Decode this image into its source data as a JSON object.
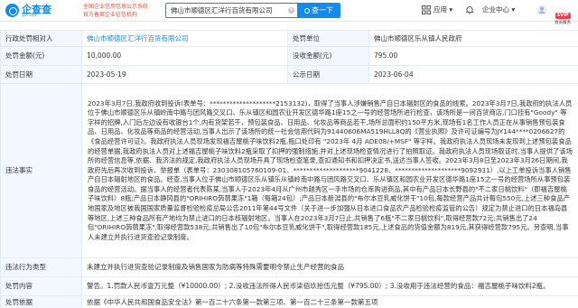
{
  "header": {
    "logo_text": "企查查",
    "logo_sub": "Qcc.com",
    "slogan_line1": "全国企业信用信息公示系统",
    "slogan_line2": "官方备案企业征信机构",
    "search_value": "佛山市顺德区汇洋行百货有限公司",
    "search_button": "查一下",
    "nav_app": "应用",
    "nav_enterprise": "企业中心",
    "svip_badge": "SVIP",
    "svip_label": "会员服务",
    "colors": {
      "brand": "#128bed",
      "slogan": "#e84e3c",
      "label_bg": "#f2f8fe"
    }
  },
  "record": {
    "labels": {
      "party": "行政处罚相对人",
      "authority": "处罚单位",
      "amount": "处罚金额(元)",
      "confiscation": "没收金额(元)",
      "decision_date": "处罚日期",
      "publish_date": "公示日期",
      "facts": "违法事实",
      "violation": "违法行为类型",
      "content": "处罚内容",
      "basis": "处罚依据"
    },
    "party": "佛山市顺德区汇洋行百货有限公司",
    "authority": "佛山市顺德区乐从镇人民政府",
    "amount": "10,000.00",
    "confiscation": "795.00",
    "decision_date": "2023-05-19",
    "publish_date": "2023-06-04",
    "facts": "2023年3月7日,我政府收到投诉(表单号：********************2153132)，取得了当事人涉嫌销售产自日本辐射区的食品的线索。2023年3月7日,我政府的执法人员位于佛山市顺德区乐从镇岭南中路与团风路交叉口、乐从镇区和园农业开发区德华路1座15之一号的经营场所进行检查，该场所是一间百货商店,门口挂有\"Goody\" 等字样的招牌,入门后左边设有收银台1个,内有货架若干，预包装食品、日用品、化妆品等商品若干,场所总面积约150平方米,现场有1名工作人员正在从事销售预包装食品、日用品、化妆品等商品的经营活动,当事人出示了该场所的统一社会信用代码为91440606MA519HLL8Q的《营业执照》及许可证编号为JY144****0206627的《食品经营许可证》。我政府执法人员现场发现福吉屋桃子味饮料2瓶,瓶口处印有 \"2023年 4月 ADE08/+MSF\" 等字样。我政府执法人员现场未发现到上述预包装食品的经营单据,我政府执法人员对上述福吉屋桃子味饮料2瓶采取了扣押的强制措施,并对上述现场检查情况进行了拍照取证。我政府执法人员现场取证时,当事人提供了该场所的经营信息等,依据、我济法的规定,我政府执法人员现场开具了现场检查笔录,查扣通知书和扣押决定书,送达当事人签收。2023年3月8日至2023年3月26日期间,我政府先后再次收到投诉、举报单（表单号：230308105760109-01、********************9041228、********************9092931）,以上工单投诉当事人销售产自日本辐射地区的食品。经查,当事人位于佛山市顺德区乐从镇乐从镇岭南中路与团风路交叉口、乐从镇区和园农业开发区德华路1座15之一号的经营场所从事预包装食品的经营活动。据当事人的经营者代表陈某,当事人于2023年4月从广州市越秀区一手市场的仓库购进商品,其中有产品日本长野县的\"不二家日桃饮料\"（即福吉屋桃子味饮料）8瓶;产品日本静冈县的\"ORIHIRO蒟蒻果冻\"1箱（每箱24包）;产品日本新潟县的\"布尔本豆乳威化饼干\"10包,每款经营产品共计每包550元,上述三种食品产地国家及地区被我国国家质量监督检验检疫总局公告2011年第44号文件（关于进一步加强从日本进口食品农产品检验检疫监管的公告）规定为禁止进口的日本福岛县等地区,上述三种食品所有产地均为禁止进口的日本核辐射地区。当事人在2023年3月7日止,共销售了6瓶\"不二家日桃饮料\",取得经营款72元;共销售出了24包\"ORIHIRO蒟蒻果冻\",取得经营款538元;共销售出了10包\"布尔本豆乳威化饼干\",取得经营款185元,上述食品的货值金额为819元,其获得经营款795元。另查明,当事人未建立并执行进货查验记录制度。",
    "violation": "未建立并执行进货查验记录制度及销售国家为防病等特殊需要明令禁止生产经营的食品",
    "content": "警告。1.罚款人民币壹万元整（¥10000.00）; 2.没收违法所得人民币柒佰玖拾伍元整（¥795.00）; 3.没收用于违法经营的食品：福吉屋桃子味饮料2瓶。",
    "basis": "依据《中华人民共和国食品安全法》第一百二十六条第一款第三项、第一百二十三条第一款第五项"
  }
}
